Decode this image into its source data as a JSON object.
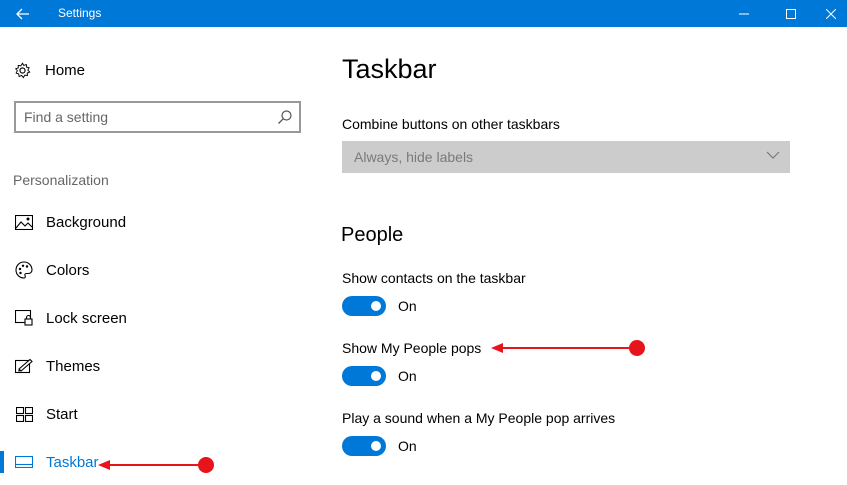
{
  "window": {
    "title": "Settings",
    "controls": {
      "minimize": "minimize-icon",
      "maximize": "maximize-icon",
      "close": "close-icon"
    }
  },
  "sidebar": {
    "home_label": "Home",
    "search": {
      "placeholder": "Find a setting"
    },
    "section_title": "Personalization",
    "items": [
      {
        "label": "Background",
        "icon": "picture-icon"
      },
      {
        "label": "Colors",
        "icon": "palette-icon"
      },
      {
        "label": "Lock screen",
        "icon": "lock-screen-icon"
      },
      {
        "label": "Themes",
        "icon": "themes-icon"
      },
      {
        "label": "Start",
        "icon": "start-tiles-icon"
      },
      {
        "label": "Taskbar",
        "icon": "taskbar-icon",
        "active": true
      }
    ]
  },
  "main": {
    "title": "Taskbar",
    "combine": {
      "label": "Combine buttons on other taskbars",
      "value": "Always, hide labels"
    },
    "people": {
      "heading": "People",
      "settings": [
        {
          "label": "Show contacts on the taskbar",
          "state": "On"
        },
        {
          "label": "Show My People pops",
          "state": "On"
        },
        {
          "label": "Play a sound when a My People pop arrives",
          "state": "On"
        }
      ]
    }
  },
  "colors": {
    "accent": "#0078d7",
    "annotation": "#e8141b"
  }
}
